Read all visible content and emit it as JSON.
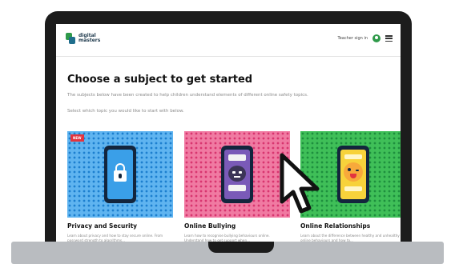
{
  "header": {
    "logo_line1": "digital",
    "logo_line2": "masters",
    "user_label": "Teacher sign in"
  },
  "main": {
    "title": "Choose a subject to get started",
    "intro": "The subjects below have been created to help children understand elements of different online safety topics.",
    "prompt": "Select which topic you would like to start with below."
  },
  "cards": [
    {
      "badge": "NEW",
      "title": "Privacy and Security",
      "description": "Learn about privacy and how to stay secure online. From password strength to algorithms...",
      "icon": "padlock-phone-icon"
    },
    {
      "title": "Online Bullying",
      "description": "Learn how to recognise bullying behaviours online. Understand how to get support when...",
      "icon": "angry-face-phone-icon"
    },
    {
      "title": "Online Relationships",
      "description": "Learn about the difference between healthy and unhealthy online behaviours and how to...",
      "icon": "winking-face-phone-icon"
    }
  ],
  "colors": {
    "brand_green": "#2f9a4a",
    "card_blue": "#5fb4f0",
    "card_pink": "#f07aa2",
    "card_green": "#3fbf58",
    "badge_red": "#e2343f"
  }
}
